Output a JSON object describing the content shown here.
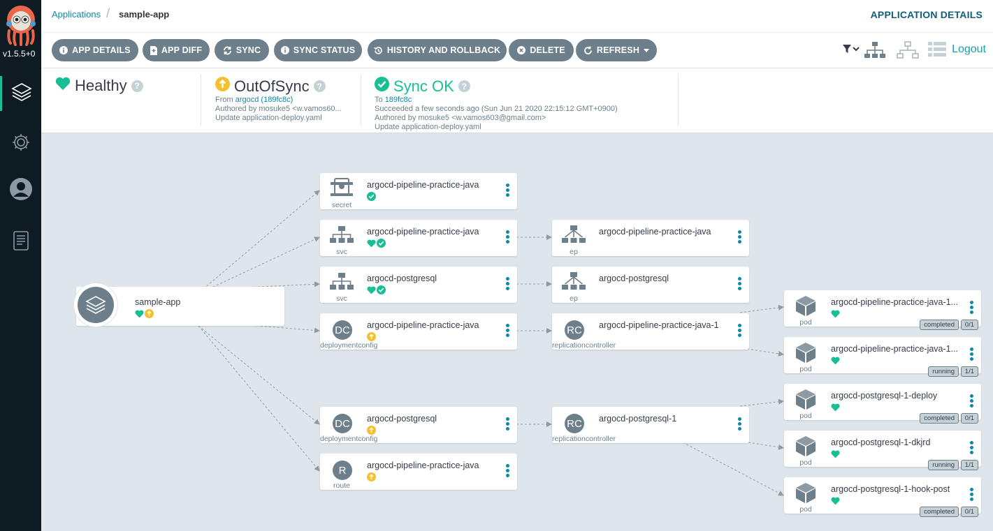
{
  "app": {
    "version": "v1.5.5+0"
  },
  "breadcrumb": {
    "parent": "Applications",
    "separator": "/",
    "current": "sample-app"
  },
  "page_title": "APPLICATION DETAILS",
  "toolbar": {
    "buttons": [
      {
        "label": "APP DETAILS",
        "icon": "info-icon"
      },
      {
        "label": "APP DIFF",
        "icon": "file-diff-icon"
      },
      {
        "label": "SYNC",
        "icon": "sync-icon"
      },
      {
        "label": "SYNC STATUS",
        "icon": "info-icon"
      },
      {
        "label": "HISTORY AND ROLLBACK",
        "icon": "history-icon"
      },
      {
        "label": "DELETE",
        "icon": "delete-icon"
      },
      {
        "label": "REFRESH",
        "icon": "refresh-icon"
      }
    ],
    "logout": "Logout"
  },
  "status": {
    "health": {
      "label": "Healthy",
      "color": "#18be94"
    },
    "sync": {
      "label": "OutOfSync",
      "color": "#f4c030",
      "from_prefix": "From ",
      "from_link": "argocd (189fc8c)",
      "author": "Authored by mosuke5 <w.vamos60...",
      "message": "Update application-deploy.yaml"
    },
    "operation": {
      "label": "Sync OK",
      "color": "#18be94",
      "to_prefix": "To ",
      "to_link": "189fc8c",
      "time": "Succeeded a few seconds ago (Sun Jun 21 2020 22:15:12 GMT+0900)",
      "author": "Authored by mosuke5 <w.vamos603@gmail.com>",
      "message": "Update application-deploy.yaml"
    }
  },
  "graph": {
    "root": {
      "name": "sample-app",
      "icon": "layers-icon"
    },
    "nodes": [
      {
        "id": "secret",
        "name": "argocd-pipeline-practice-java",
        "kind": "secret",
        "icon": "secret-icon",
        "badges": [
          "synced"
        ]
      },
      {
        "id": "svc1",
        "name": "argocd-pipeline-practice-java",
        "kind": "svc",
        "icon": "network-icon",
        "badges": [
          "healthy",
          "synced"
        ]
      },
      {
        "id": "svc2",
        "name": "argocd-postgresql",
        "kind": "svc",
        "icon": "network-icon",
        "badges": [
          "healthy",
          "synced"
        ]
      },
      {
        "id": "dc1",
        "name": "argocd-pipeline-practice-java",
        "kind": "deploymentconfig",
        "abbr": "DC",
        "badges": [
          "outofsync"
        ]
      },
      {
        "id": "dc2",
        "name": "argocd-postgresql",
        "kind": "deploymentconfig",
        "abbr": "DC",
        "badges": [
          "outofsync"
        ]
      },
      {
        "id": "route",
        "name": "argocd-pipeline-practice-java",
        "kind": "route",
        "abbr": "R",
        "badges": [
          "outofsync"
        ]
      },
      {
        "id": "ep1",
        "name": "argocd-pipeline-practice-java",
        "kind": "ep",
        "icon": "endpoints-icon",
        "badges": []
      },
      {
        "id": "ep2",
        "name": "argocd-postgresql",
        "kind": "ep",
        "icon": "endpoints-icon",
        "badges": []
      },
      {
        "id": "rc1",
        "name": "argocd-pipeline-practice-java-1",
        "kind": "replicationcontroller",
        "abbr": "RC",
        "badges": []
      },
      {
        "id": "rc2",
        "name": "argocd-postgresql-1",
        "kind": "replicationcontroller",
        "abbr": "RC",
        "badges": []
      },
      {
        "id": "pod1",
        "name": "argocd-pipeline-practice-java-1...",
        "kind": "pod",
        "icon": "cube-icon",
        "badges": [
          "healthy"
        ],
        "state": "completed",
        "ready": "0/1"
      },
      {
        "id": "pod2",
        "name": "argocd-pipeline-practice-java-1...",
        "kind": "pod",
        "icon": "cube-icon",
        "badges": [
          "healthy"
        ],
        "state": "running",
        "ready": "1/1"
      },
      {
        "id": "pod3",
        "name": "argocd-postgresql-1-deploy",
        "kind": "pod",
        "icon": "cube-icon",
        "badges": [
          "healthy"
        ],
        "state": "completed",
        "ready": "0/1"
      },
      {
        "id": "pod4",
        "name": "argocd-postgresql-1-dkjrd",
        "kind": "pod",
        "icon": "cube-icon",
        "badges": [
          "healthy"
        ],
        "state": "running",
        "ready": "1/1"
      },
      {
        "id": "pod5",
        "name": "argocd-postgresql-1-hook-post",
        "kind": "pod",
        "icon": "cube-icon",
        "badges": [
          "healthy"
        ],
        "state": "completed",
        "ready": "0/1"
      }
    ]
  },
  "colors": {
    "healthy": "#18be94",
    "outofsync": "#f4c030",
    "link": "#0d88a6",
    "sidebar": "#0e1b22"
  }
}
